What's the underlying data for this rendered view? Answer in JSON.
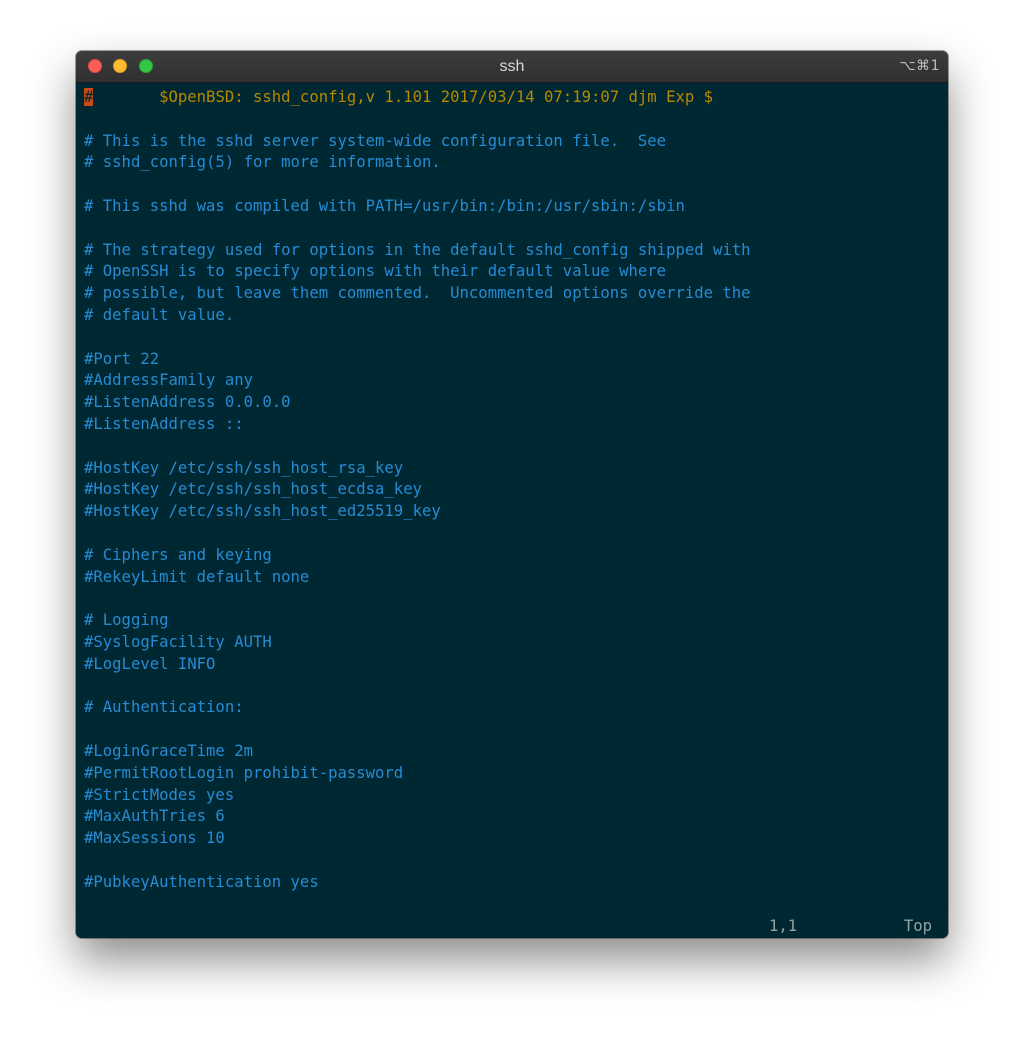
{
  "window": {
    "title": "ssh",
    "shortcut": "⌥⌘1"
  },
  "colors": {
    "background": "#002833",
    "comment": "#268bd2",
    "header": "#b58900",
    "cursor": "#cb4b16"
  },
  "editor": {
    "cursor_char": "#",
    "header_rest": "       $OpenBSD: sshd_config,v 1.101 2017/03/14 07:19:07 djm Exp $",
    "lines": [
      "",
      "# This is the sshd server system-wide configuration file.  See",
      "# sshd_config(5) for more information.",
      "",
      "# This sshd was compiled with PATH=/usr/bin:/bin:/usr/sbin:/sbin",
      "",
      "# The strategy used for options in the default sshd_config shipped with",
      "# OpenSSH is to specify options with their default value where",
      "# possible, but leave them commented.  Uncommented options override the",
      "# default value.",
      "",
      "#Port 22",
      "#AddressFamily any",
      "#ListenAddress 0.0.0.0",
      "#ListenAddress ::",
      "",
      "#HostKey /etc/ssh/ssh_host_rsa_key",
      "#HostKey /etc/ssh/ssh_host_ecdsa_key",
      "#HostKey /etc/ssh/ssh_host_ed25519_key",
      "",
      "# Ciphers and keying",
      "#RekeyLimit default none",
      "",
      "# Logging",
      "#SyslogFacility AUTH",
      "#LogLevel INFO",
      "",
      "# Authentication:",
      "",
      "#LoginGraceTime 2m",
      "#PermitRootLogin prohibit-password",
      "#StrictModes yes",
      "#MaxAuthTries 6",
      "#MaxSessions 10",
      "",
      "#PubkeyAuthentication yes",
      ""
    ]
  },
  "status": {
    "position": "1,1",
    "scroll": "Top"
  }
}
